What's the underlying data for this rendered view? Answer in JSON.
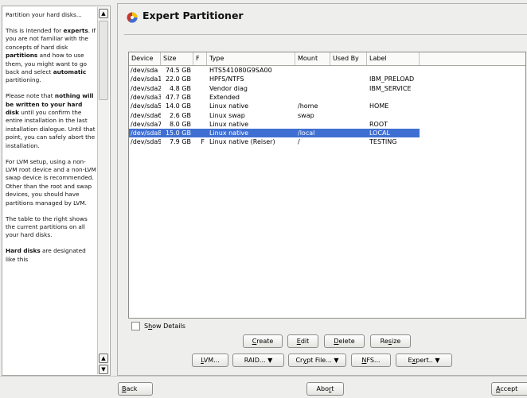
{
  "help": {
    "paragraphs": [
      [
        {
          "t": "Partition your hard disks..."
        }
      ],
      [
        {
          "t": "This is intended for "
        },
        {
          "t": "experts",
          "b": true
        },
        {
          "t": ". If you are not familiar with the concepts of hard disk "
        },
        {
          "t": "partitions",
          "b": true
        },
        {
          "t": " and how to use them, you might want to go back and select "
        },
        {
          "t": "automatic",
          "b": true
        },
        {
          "t": " partitioning."
        }
      ],
      [
        {
          "t": "Please note that "
        },
        {
          "t": "nothing will be written to your hard disk",
          "b": true
        },
        {
          "t": " until you confirm the entire installation in the last installation dialogue. Until that point, you can safely abort the installation."
        }
      ],
      [
        {
          "t": "For LVM setup, using a non-LVM root device and a non-LVM swap device is recommended. Other than the root and swap devices, you should have partitions managed by LVM."
        }
      ],
      [
        {
          "t": "The table to the right shows the current partitions on all your hard disks."
        }
      ],
      [
        {
          "t": "Hard disks",
          "b": true
        },
        {
          "t": " are designated like this"
        }
      ]
    ],
    "scroll_up": "▲",
    "scroll_down": "▼"
  },
  "dialog": {
    "title": "Expert Partitioner"
  },
  "table": {
    "columns": [
      "Device",
      "Size",
      "F",
      "Type",
      "Mount",
      "Used By",
      "Label"
    ],
    "rows": [
      {
        "device": "/dev/sda",
        "size": "74.5 GB",
        "f": "",
        "type": "HTS541080G9SA00",
        "mount": "",
        "used_by": "",
        "label": ""
      },
      {
        "device": "/dev/sda1",
        "size": "22.0 GB",
        "f": "",
        "type": "HPFS/NTFS",
        "mount": "",
        "used_by": "",
        "label": "IBM_PRELOAD"
      },
      {
        "device": "/dev/sda2",
        "size": "4.8 GB",
        "f": "",
        "type": "Vendor diag",
        "mount": "",
        "used_by": "",
        "label": "IBM_SERVICE"
      },
      {
        "device": "/dev/sda3",
        "size": "47.7 GB",
        "f": "",
        "type": "Extended",
        "mount": "",
        "used_by": "",
        "label": ""
      },
      {
        "device": "/dev/sda5",
        "size": "14.0 GB",
        "f": "",
        "type": "Linux native",
        "mount": "/home",
        "used_by": "",
        "label": "HOME"
      },
      {
        "device": "/dev/sda6",
        "size": "2.6 GB",
        "f": "",
        "type": "Linux swap",
        "mount": "swap",
        "used_by": "",
        "label": ""
      },
      {
        "device": "/dev/sda7",
        "size": "8.0 GB",
        "f": "",
        "type": "Linux native",
        "mount": "",
        "used_by": "",
        "label": "ROOT"
      },
      {
        "device": "/dev/sda8",
        "size": "15.0 GB",
        "f": "",
        "type": "Linux native",
        "mount": "/local",
        "used_by": "",
        "label": "LOCAL",
        "selected": true
      },
      {
        "device": "/dev/sda9",
        "size": "7.9 GB",
        "f": "F",
        "type": "Linux native (Reiser)",
        "mount": "/",
        "used_by": "",
        "label": "TESTING"
      }
    ],
    "selected_color": "#3f6fd2"
  },
  "show_details": {
    "label_pre": "S",
    "label_key": "h",
    "label_post": "ow Details",
    "checked": false
  },
  "actions_row1": [
    {
      "pre": "",
      "key": "C",
      "post": "reate"
    },
    {
      "pre": "",
      "key": "E",
      "post": "dit"
    },
    {
      "pre": "",
      "key": "D",
      "post": "elete"
    },
    {
      "pre": "Re",
      "key": "s",
      "post": "ize"
    }
  ],
  "actions_row2": [
    {
      "pre": "",
      "key": "L",
      "post": "VM..."
    },
    {
      "pre": "RAID... ",
      "key": "",
      "post": "▼"
    },
    {
      "pre": "Cr",
      "key": "y",
      "post": "pt File... ▼"
    },
    {
      "pre": "",
      "key": "N",
      "post": "FS..."
    },
    {
      "pre": "E",
      "key": "x",
      "post": "pert.. ▼"
    }
  ],
  "footer": {
    "back": {
      "pre": "",
      "key": "B",
      "post": "ack"
    },
    "abort": {
      "pre": "Abo",
      "key": "r",
      "post": "t"
    },
    "accept": {
      "pre": "",
      "key": "A",
      "post": "ccept"
    }
  },
  "icons": [
    "partitioner-icon",
    "scroll-up-icon",
    "scroll-down-icon",
    "dropdown-arrow-icon"
  ]
}
